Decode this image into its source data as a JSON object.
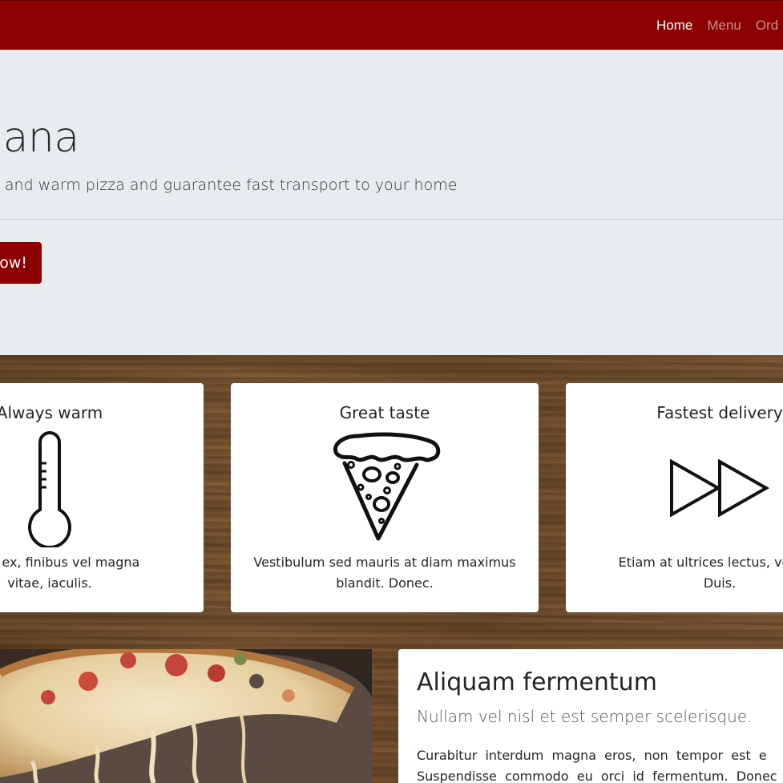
{
  "nav": {
    "links": [
      {
        "label": "Home"
      },
      {
        "label": "Menu"
      },
      {
        "label": "Ord"
      }
    ]
  },
  "hero": {
    "title": "Pizzeriana",
    "lead": "We make really tasty and warm pizza and guarantee fast transport to your home",
    "button_label": "Order now!"
  },
  "features": [
    {
      "title": "Always warm",
      "icon": "thermometer-icon",
      "text_lines": [
        "e felis ex, finibus vel magna",
        "vitae, iaculis."
      ]
    },
    {
      "title": "Great taste",
      "icon": "pizza-slice-icon",
      "text_lines": [
        "Vestibulum sed mauris at diam maximus",
        "blandit. Donec."
      ]
    },
    {
      "title": "Fastest delivery",
      "icon": "fast-forward-icon",
      "text_lines": [
        "Etiam at ultrices lectus, vel veh",
        "Duis."
      ]
    }
  ],
  "article": {
    "title": "Aliquam fermentum",
    "subtitle": "Nullam vel nisl et est semper scelerisque.",
    "body_lines": [
      "Curabitur  interdum  magna  eros,  non  tempor  est  e",
      "Suspendisse  commodo  eu  orci  id  fermentum.  Donec  ultr"
    ]
  },
  "colors": {
    "brand": "#8b0000",
    "hero_bg": "#e9ecef"
  }
}
